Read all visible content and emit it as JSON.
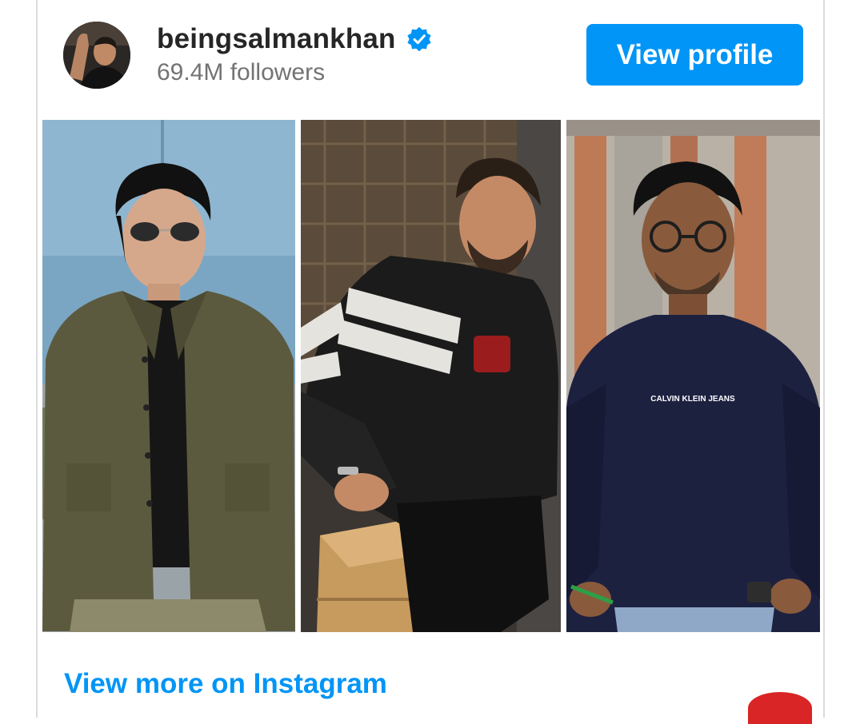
{
  "profile": {
    "username": "beingsalmankhan",
    "followers": "69.4M followers",
    "verified": true,
    "view_profile_label": "View profile"
  },
  "post": {
    "images": [
      {
        "name": "post-image-left"
      },
      {
        "name": "post-image-center"
      },
      {
        "name": "post-image-right"
      }
    ],
    "shirt_brand_text": "CALVIN KLEIN JEANS"
  },
  "footer": {
    "view_more_label": "View more on Instagram"
  },
  "colors": {
    "accent": "#0095f6",
    "username": "#262626",
    "muted": "#737373",
    "border": "#dbdbdb",
    "badge": "#d92525"
  },
  "icons": {
    "verified": "verified-badge-icon"
  }
}
